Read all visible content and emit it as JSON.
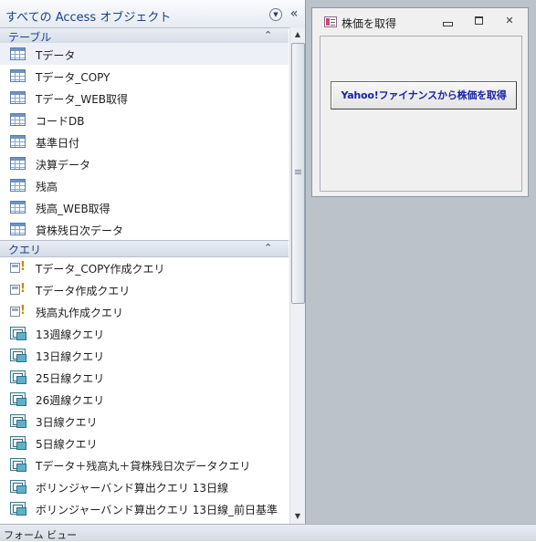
{
  "nav": {
    "title": "すべての Access オブジェクト",
    "dropdown_icon": "chevron-down-circle-icon",
    "collapse_glyph": "«"
  },
  "groups": [
    {
      "label": "テーブル",
      "collapse_glyph": "⌃",
      "items": [
        {
          "label": "Tデータ",
          "icon": "table-icon"
        },
        {
          "label": "Tデータ_COPY",
          "icon": "table-icon"
        },
        {
          "label": "Tデータ_WEB取得",
          "icon": "table-icon"
        },
        {
          "label": "コードDB",
          "icon": "table-icon"
        },
        {
          "label": "基準日付",
          "icon": "table-icon"
        },
        {
          "label": "決算データ",
          "icon": "table-icon"
        },
        {
          "label": "残高",
          "icon": "table-icon"
        },
        {
          "label": "残高_WEB取得",
          "icon": "table-icon"
        },
        {
          "label": "貸株残日次データ",
          "icon": "table-icon"
        }
      ]
    },
    {
      "label": "クエリ",
      "collapse_glyph": "⌃",
      "items": [
        {
          "label": "Tデータ_COPY作成クエリ",
          "icon": "make-table-query-icon"
        },
        {
          "label": "Tデータ作成クエリ",
          "icon": "make-table-query-icon"
        },
        {
          "label": "残高丸作成クエリ",
          "icon": "make-table-query-icon"
        },
        {
          "label": "13週線クエリ",
          "icon": "select-query-icon"
        },
        {
          "label": "13日線クエリ",
          "icon": "select-query-icon"
        },
        {
          "label": "25日線クエリ",
          "icon": "select-query-icon"
        },
        {
          "label": "26週線クエリ",
          "icon": "select-query-icon"
        },
        {
          "label": "3日線クエリ",
          "icon": "select-query-icon"
        },
        {
          "label": "5日線クエリ",
          "icon": "select-query-icon"
        },
        {
          "label": "Tデータ＋残高丸＋貸株残日次データクエリ",
          "icon": "select-query-icon"
        },
        {
          "label": "ボリンジャーバンド算出クエリ 13日線",
          "icon": "select-query-icon"
        },
        {
          "label": "ボリンジャーバンド算出クエリ 13日線_前日基準",
          "icon": "select-query-icon"
        }
      ]
    }
  ],
  "scrollbar": {
    "up_glyph": "▲",
    "down_glyph": "▼",
    "position_fraction": 0
  },
  "form": {
    "title": "株価を取得",
    "minimize_glyph": "▭",
    "restore_glyph": "⧉",
    "close_glyph": "✕",
    "button_label": "Yahoo!ファイナンスから株価を取得"
  },
  "status_bar": {
    "text": "フォーム ビュー"
  },
  "colors": {
    "group_header_text": "#15428b",
    "button_text": "#1a22a8",
    "workspace_bg": "#bcc2ca"
  }
}
